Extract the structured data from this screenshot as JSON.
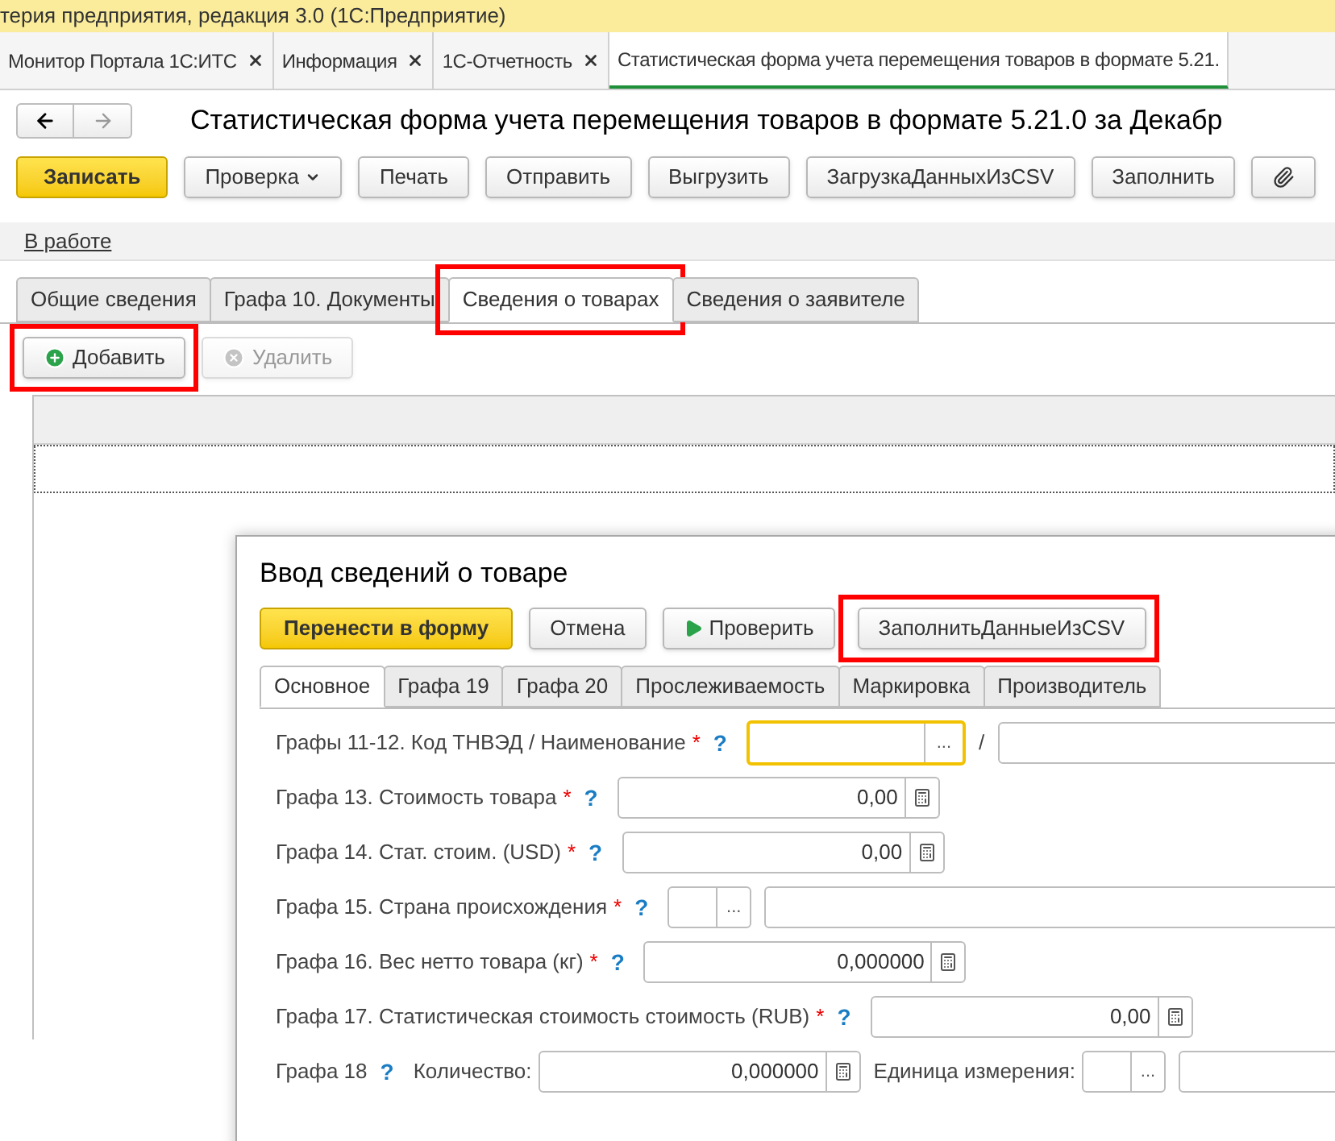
{
  "app_title": "терия предприятия, редакция 3.0  (1С:Предприятие)",
  "open_tabs": [
    {
      "label": "Монитор Портала 1С:ИТС",
      "selected": false
    },
    {
      "label": "Информация",
      "selected": false
    },
    {
      "label": "1С-Отчетность",
      "selected": false
    },
    {
      "label": "Статистическая форма учета перемещения товаров в формате 5.21.",
      "selected": true
    }
  ],
  "form_title": "Статистическая форма учета перемещения товаров в формате 5.21.0 за Декабр",
  "toolbar": [
    {
      "kind": "primary",
      "label": "Записать"
    },
    {
      "kind": "dropdown",
      "label": "Проверка"
    },
    {
      "kind": "normal",
      "label": "Печать"
    },
    {
      "kind": "normal",
      "label": "Отправить"
    },
    {
      "kind": "normal",
      "label": "Выгрузить"
    },
    {
      "kind": "normal",
      "label": "ЗагрузкаДанныхИзCSV"
    },
    {
      "kind": "normal",
      "label": "Заполнить"
    },
    {
      "kind": "attach"
    }
  ],
  "status_link": "В работе",
  "form_tabs": [
    {
      "label": "Общие сведения",
      "selected": false
    },
    {
      "label": "Графа 10. Документы",
      "selected": false
    },
    {
      "label": "Сведения о товарах",
      "selected": true,
      "highlighted": true
    },
    {
      "label": "Сведения о заявителе",
      "selected": false
    }
  ],
  "table_toolbar": [
    {
      "kind": "add",
      "label": "Добавить",
      "disabled": false,
      "highlighted": true
    },
    {
      "kind": "delete",
      "label": "Удалить",
      "disabled": true
    }
  ],
  "dialog": {
    "title": "Ввод сведений о товаре",
    "buttons": [
      {
        "kind": "primary",
        "label": "Перенести в форму"
      },
      {
        "kind": "normal",
        "label": "Отмена"
      },
      {
        "kind": "play",
        "label": "Проверить"
      },
      {
        "kind": "normal",
        "label": "ЗаполнитьДанныеИзCSV",
        "highlighted": true
      }
    ],
    "tabs": [
      {
        "label": "Основное",
        "selected": true
      },
      {
        "label": "Графа 19",
        "selected": false
      },
      {
        "label": "Графа 20",
        "selected": false
      },
      {
        "label": "Прослеживаемость",
        "selected": false
      },
      {
        "label": "Маркировка",
        "selected": false
      },
      {
        "label": "Производитель",
        "selected": false
      }
    ],
    "rows": [
      {
        "label": "Графы 11-12. Код ТНВЭД / Наименование",
        "required_mark": "*",
        "help": "?",
        "controls": [
          {
            "kind": "select",
            "button": "...",
            "focused": true
          },
          {
            "kind": "separator",
            "text": "/"
          },
          {
            "kind": "text"
          }
        ]
      },
      {
        "label": "Графа 13. Стоимость товара",
        "required_mark": "*",
        "help": "?",
        "controls": [
          {
            "kind": "number",
            "value": "0,00"
          }
        ]
      },
      {
        "label": "Графа 14. Стат. стоим. (USD)",
        "required_mark": "*",
        "help": "?",
        "controls": [
          {
            "kind": "number",
            "value": "0,00"
          }
        ]
      },
      {
        "label": "Графа 15. Страна происхождения",
        "required_mark": "*",
        "help": "?",
        "controls": [
          {
            "kind": "code",
            "button": "..."
          },
          {
            "kind": "text"
          }
        ]
      },
      {
        "label": "Графа 16. Вес нетто товара (кг)",
        "required_mark": "*",
        "help": "?",
        "controls": [
          {
            "kind": "number",
            "value": "0,000000"
          }
        ]
      },
      {
        "label": "Графа 17. Статистическая стоимость стоимость (RUB)",
        "required_mark": "*",
        "help": "?",
        "controls": [
          {
            "kind": "number",
            "value": "0,00"
          }
        ]
      },
      {
        "label": "Графа 18",
        "help": "?",
        "controls": [
          {
            "kind": "label",
            "text": "Количество:"
          },
          {
            "kind": "number",
            "value": "0,000000"
          },
          {
            "kind": "label",
            "text": "Единица измерения:"
          },
          {
            "kind": "code",
            "button": "..."
          },
          {
            "kind": "text"
          }
        ]
      }
    ]
  }
}
